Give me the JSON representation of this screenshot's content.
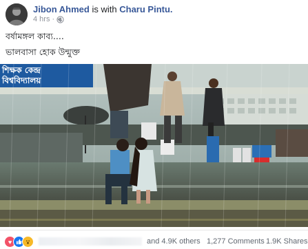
{
  "post": {
    "author": "Jibon Ahmed",
    "with_text": "is with",
    "tagged": "Charu Pintu.",
    "time": "4 hrs",
    "separator": "·",
    "privacy_icon": "globe-icon",
    "text_line1": "বর্ষামঙ্গল কাব্য....",
    "text_line2": "ভালবাসা হোক উন্মুক্ত"
  },
  "photo": {
    "sign_line1": "শিক্ষক কেন্দ্র",
    "sign_line2": "বিশ্ববিদ্যালয়"
  },
  "footer": {
    "reaction_icons": [
      "love-icon",
      "like-icon",
      "wow-icon"
    ],
    "reactions_suffix": "and 4.9K others",
    "comments": "1,277 Comments",
    "shares": "1.9K Shares"
  },
  "colors": {
    "link": "#385898",
    "meta": "#90949c",
    "sign_blue": "#1e5aa0",
    "love": "#f25268",
    "like": "#1877f2",
    "wow": "#f7b928"
  }
}
